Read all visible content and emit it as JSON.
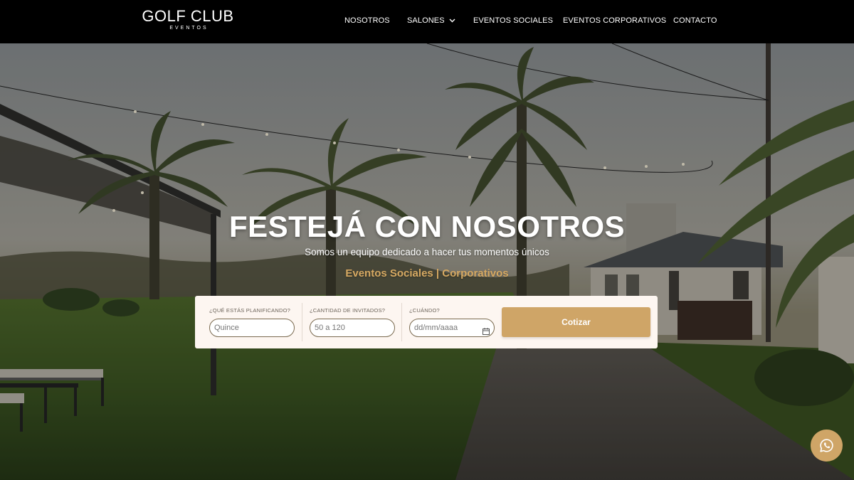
{
  "brand": {
    "name": "GOLF CLUB",
    "sub": "EVENTOS"
  },
  "nav": {
    "items": [
      {
        "label": "NOSOTROS"
      },
      {
        "label": "SALONES",
        "has_dropdown": true
      },
      {
        "label": "EVENTOS SOCIALES"
      },
      {
        "label": "EVENTOS CORPORATIVOS"
      },
      {
        "label": "CONTACTO"
      }
    ]
  },
  "hero": {
    "title": "FESTEJÁ CON NOSOTROS",
    "subtitle": "Somos un equipo dedicado a hacer tus momentos únicos",
    "tagline": "Eventos Sociales | Corporativos"
  },
  "quote_form": {
    "event_type": {
      "label": "¿QUÉ ESTÁS PLANIFICANDO?",
      "placeholder": "Quince"
    },
    "guests": {
      "label": "¿CANTIDAD DE INVITADOS?",
      "placeholder": "50 a 120"
    },
    "date": {
      "label": "¿CUÁNDO?",
      "placeholder": "dd/mm/aaaa"
    },
    "submit_label": "Cotizar"
  },
  "colors": {
    "accent": "#cfa567",
    "tagline": "#d6a962",
    "navbar": "#000000",
    "form_bg": "#fdf6f1"
  },
  "icons": {
    "dropdown": "chevron-down-icon",
    "date": "calendar-icon",
    "whatsapp": "whatsapp-icon"
  }
}
